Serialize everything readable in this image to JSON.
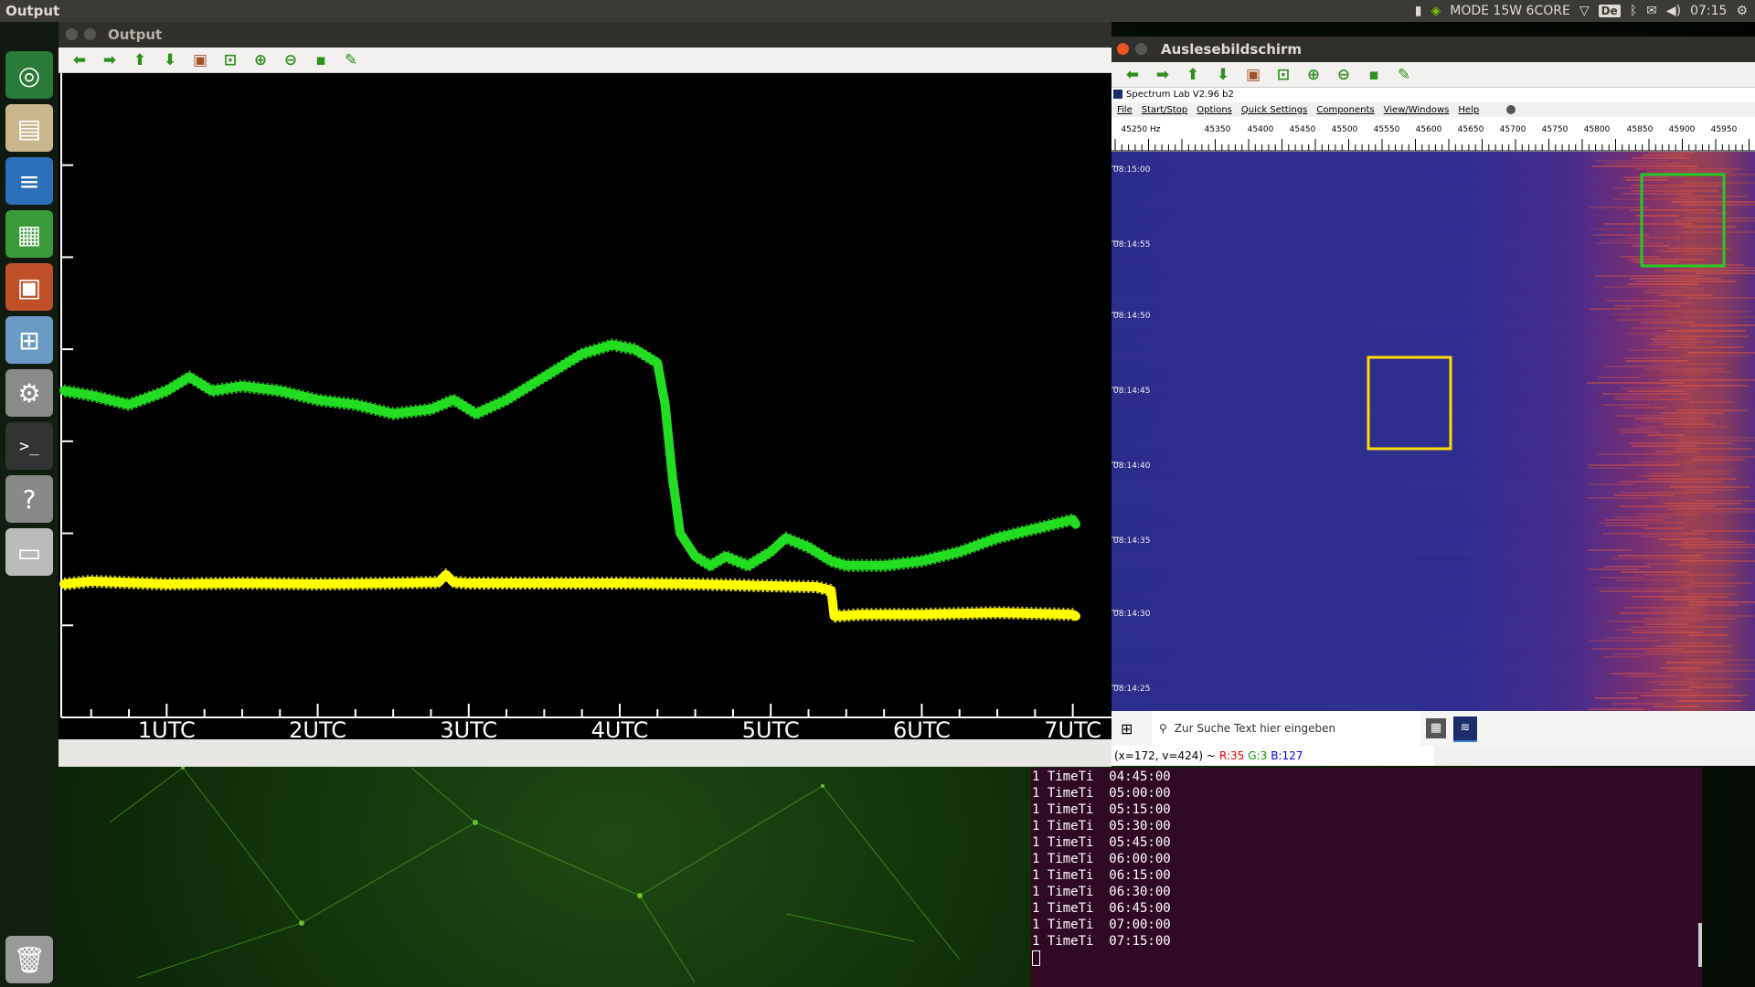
{
  "topbar": {
    "app_title": "Output",
    "mode": "MODE 15W 6CORE",
    "keyboard": "De",
    "time": "07:15"
  },
  "launcher": {
    "items": [
      {
        "name": "ubuntu-logo-icon",
        "glyph": "◎",
        "color": "#2a7a3a"
      },
      {
        "name": "files-icon",
        "glyph": "▤",
        "color": "#c9b68c"
      },
      {
        "name": "writer-icon",
        "glyph": "≡",
        "color": "#2d6fb8"
      },
      {
        "name": "calc-icon",
        "glyph": "▦",
        "color": "#3a9a3a"
      },
      {
        "name": "impress-icon",
        "glyph": "▣",
        "color": "#c0502a"
      },
      {
        "name": "software-icon",
        "glyph": "⊞",
        "color": "#6b9bc4"
      },
      {
        "name": "settings-icon",
        "glyph": "⚙",
        "color": "#8a8a8a"
      },
      {
        "name": "terminal-icon",
        "glyph": ">_",
        "color": "#333"
      },
      {
        "name": "help-icon",
        "glyph": "?",
        "color": "#888"
      },
      {
        "name": "drive-icon",
        "glyph": "▭",
        "color": "#bbb"
      },
      {
        "name": "trash-icon",
        "glyph": "🗑",
        "color": "#999"
      }
    ]
  },
  "output_window": {
    "title": "Output",
    "toolbar": [
      "arrow-left-icon",
      "arrow-right-icon",
      "arrow-up-icon",
      "arrow-down-icon",
      "image-icon",
      "zoom-fit-icon",
      "zoom-in-icon",
      "zoom-out-icon",
      "save-icon",
      "brush-icon"
    ]
  },
  "chart_data": {
    "type": "line",
    "title": "",
    "xlabel": "",
    "ylabel": "",
    "x_ticks": [
      "1UTC",
      "2UTC",
      "3UTC",
      "4UTC",
      "5UTC",
      "6UTC",
      "7UTC"
    ],
    "x_tick_hours": [
      1,
      2,
      3,
      4,
      5,
      6,
      7
    ],
    "xlim": [
      0.32,
      7.22
    ],
    "ylim": [
      0,
      7
    ],
    "y_tick_values": [
      1,
      2,
      3,
      4,
      5,
      6
    ],
    "grid": false,
    "background": "#000000",
    "series": [
      {
        "color": "#22dd22",
        "x": [
          0.32,
          0.5,
          0.75,
          1.0,
          1.15,
          1.3,
          1.5,
          1.75,
          2.0,
          2.25,
          2.5,
          2.75,
          2.9,
          3.05,
          3.25,
          3.5,
          3.75,
          3.95,
          4.1,
          4.25,
          4.3,
          4.35,
          4.4,
          4.5,
          4.6,
          4.7,
          4.85,
          5.0,
          5.1,
          5.25,
          5.4,
          5.5,
          5.75,
          6.0,
          6.25,
          6.5,
          6.75,
          7.0,
          7.02
        ],
        "y": [
          3.55,
          3.5,
          3.4,
          3.55,
          3.7,
          3.55,
          3.6,
          3.55,
          3.45,
          3.4,
          3.3,
          3.35,
          3.45,
          3.3,
          3.45,
          3.7,
          3.95,
          4.05,
          4.0,
          3.85,
          3.4,
          2.6,
          2.0,
          1.75,
          1.65,
          1.75,
          1.65,
          1.8,
          1.95,
          1.85,
          1.7,
          1.65,
          1.65,
          1.7,
          1.8,
          1.95,
          2.05,
          2.15,
          2.1
        ]
      },
      {
        "color": "#ffff00",
        "x": [
          0.32,
          0.5,
          1.0,
          1.5,
          2.0,
          2.5,
          2.8,
          2.85,
          2.9,
          3.0,
          3.5,
          4.0,
          4.5,
          5.0,
          5.3,
          5.4,
          5.42,
          5.6,
          6.0,
          6.5,
          7.0,
          7.02
        ],
        "y": [
          1.45,
          1.48,
          1.45,
          1.46,
          1.45,
          1.46,
          1.47,
          1.55,
          1.47,
          1.46,
          1.46,
          1.46,
          1.45,
          1.43,
          1.42,
          1.38,
          1.1,
          1.12,
          1.12,
          1.14,
          1.12,
          1.1
        ]
      }
    ]
  },
  "spectrum_window": {
    "title": "Auslesebildschirm",
    "app_title": "Spectrum Lab V2.96 b2",
    "menu": [
      "File",
      "Start/Stop",
      "Options",
      "Quick Settings",
      "Components",
      "View/Windows",
      "Help"
    ],
    "freq_labels": [
      "45250 Hz",
      "45350",
      "45400",
      "45450",
      "45500",
      "45550",
      "45600",
      "45650",
      "45700",
      "45750",
      "45800",
      "45850",
      "45900",
      "45950"
    ],
    "time_labels": [
      "08:15:00",
      "08:14:55",
      "08:14:50",
      "08:14:45",
      "08:14:40",
      "08:14:35",
      "08:14:30",
      "08:14:25"
    ],
    "search_placeholder": "Zur Suche Text hier eingeben",
    "status": {
      "coords": "(x=172, v=424) ~",
      "r": "R:35",
      "g": "G:3",
      "b": "B:127"
    }
  },
  "terminal": {
    "lines": [
      "1 TimeTi  04:45:00",
      "1 TimeTi  05:00:00",
      "1 TimeTi  05:15:00",
      "1 TimeTi  05:30:00",
      "1 TimeTi  05:45:00",
      "1 TimeTi  06:00:00",
      "1 TimeTi  06:15:00",
      "1 TimeTi  06:30:00",
      "1 TimeTi  06:45:00",
      "1 TimeTi  07:00:00",
      "1 TimeTi  07:15:00"
    ]
  }
}
